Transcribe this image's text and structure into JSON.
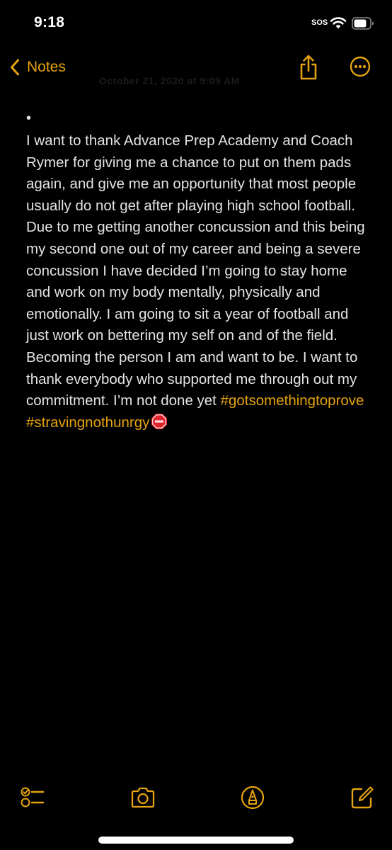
{
  "status_bar": {
    "time": "9:18",
    "sos": "SOS",
    "icons": [
      "wifi-icon",
      "battery-icon"
    ]
  },
  "nav": {
    "back_label": "Notes",
    "back_icon": "chevron-left-icon",
    "share_icon": "share-icon",
    "more_icon": "more-icon",
    "accent_color": "#e5a30f"
  },
  "note": {
    "faded_date": "October 21, 2020 at 9:09 AM",
    "bullet": "•",
    "body": " I want to thank Advance Prep Academy and Coach Rymer  for giving me a chance to put on them pads again, and give me an opportunity that most people usually do not get after playing high school football. Due to me getting another concussion and this being my second one out of my career and being a severe concussion I have decided I’m  going to stay home and work on my body mentally, physically and emotionally. I am going to sit a year of football and just work on bettering my self on and of the field. Becoming the person I am and want to be. I want to thank everybody who supported me through out my commitment. I’m not done yet",
    "hashtags": "#gotsomethingtoprove #stravingnothunrgy",
    "trailing_emoji": "stop-sign-icon"
  },
  "toolbar": {
    "icons": [
      "checklist-icon",
      "camera-icon",
      "markup-icon",
      "compose-icon"
    ]
  }
}
